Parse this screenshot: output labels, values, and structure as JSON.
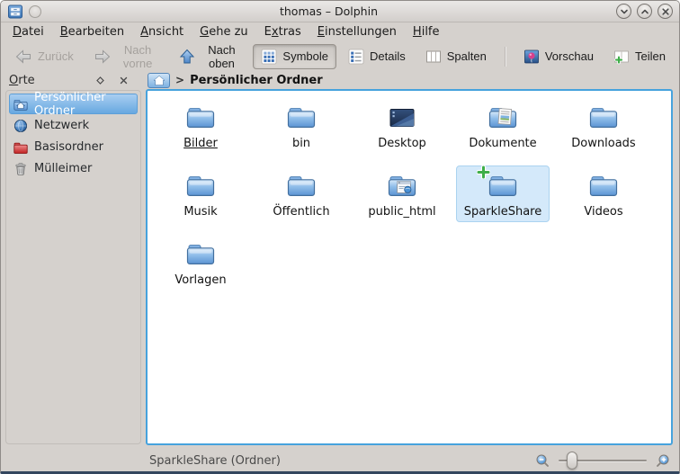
{
  "colors": {
    "window_background": "#d5d1cd",
    "view_border_active": "#46a2dd",
    "file_selection_fill": "#d4e9fa",
    "sidebar_selection_start": "#a9cef1",
    "sidebar_selection_end": "#67a8e0",
    "folder_blue": "#5c94d3",
    "emblem_green": "#3fae49"
  },
  "window": {
    "title": "thomas – Dolphin",
    "app_icon": "dolphin-app",
    "controls": [
      {
        "name": "minimize",
        "glyph": "chevron-down"
      },
      {
        "name": "maximize",
        "glyph": "chevron-up"
      },
      {
        "name": "close",
        "glyph": "cross"
      }
    ]
  },
  "menubar": {
    "items": [
      {
        "label": "Datei",
        "mnemonic": 0
      },
      {
        "label": "Bearbeiten",
        "mnemonic": 0
      },
      {
        "label": "Ansicht",
        "mnemonic": 0
      },
      {
        "label": "Gehe zu",
        "mnemonic": 0
      },
      {
        "label": "Extras",
        "mnemonic": 1
      },
      {
        "label": "Einstellungen",
        "mnemonic": 0
      },
      {
        "label": "Hilfe",
        "mnemonic": 0
      }
    ]
  },
  "toolbar": {
    "buttons": [
      {
        "label": "Zurück",
        "icon": "arrow-left",
        "enabled": false
      },
      {
        "label": "Nach vorne",
        "icon": "arrow-right",
        "enabled": false
      },
      {
        "label": "Nach oben",
        "icon": "arrow-up",
        "enabled": true
      },
      {
        "label": "Symbole",
        "icon": "icons-view",
        "enabled": true,
        "pressed": true
      },
      {
        "label": "Details",
        "icon": "details-view",
        "enabled": true
      },
      {
        "label": "Spalten",
        "icon": "columns-view",
        "enabled": true
      },
      {
        "type": "separator"
      },
      {
        "label": "Vorschau",
        "icon": "preview",
        "enabled": true
      },
      {
        "label": "Teilen",
        "icon": "split-add",
        "enabled": true
      }
    ]
  },
  "places_panel": {
    "title": "Orte",
    "title_mnemonic": 0,
    "items": [
      {
        "label": "Persönlicher Ordner",
        "icon": "user-home",
        "selected": true
      },
      {
        "label": "Netzwerk",
        "icon": "network",
        "selected": false
      },
      {
        "label": "Basisordner",
        "icon": "root-folder",
        "selected": false
      },
      {
        "label": "Mülleimer",
        "icon": "trash",
        "selected": false
      }
    ]
  },
  "breadcrumb": {
    "separator": ">",
    "current": "Persönlicher Ordner"
  },
  "files": [
    {
      "name": "Bilder",
      "icon": "folder",
      "underlined": true
    },
    {
      "name": "bin",
      "icon": "folder"
    },
    {
      "name": "Desktop",
      "icon": "desktop"
    },
    {
      "name": "Dokumente",
      "icon": "folder-documents"
    },
    {
      "name": "Downloads",
      "icon": "folder"
    },
    {
      "name": "Musik",
      "icon": "folder"
    },
    {
      "name": "Öffentlich",
      "icon": "folder"
    },
    {
      "name": "public_html",
      "icon": "folder-html"
    },
    {
      "name": "SparkleShare",
      "icon": "folder",
      "emblem": "plus",
      "selected": true
    },
    {
      "name": "Videos",
      "icon": "folder"
    },
    {
      "name": "Vorlagen",
      "icon": "folder"
    }
  ],
  "statusbar": {
    "text": "SparkleShare (Ordner)",
    "zoom_slider_value": 0.1
  }
}
